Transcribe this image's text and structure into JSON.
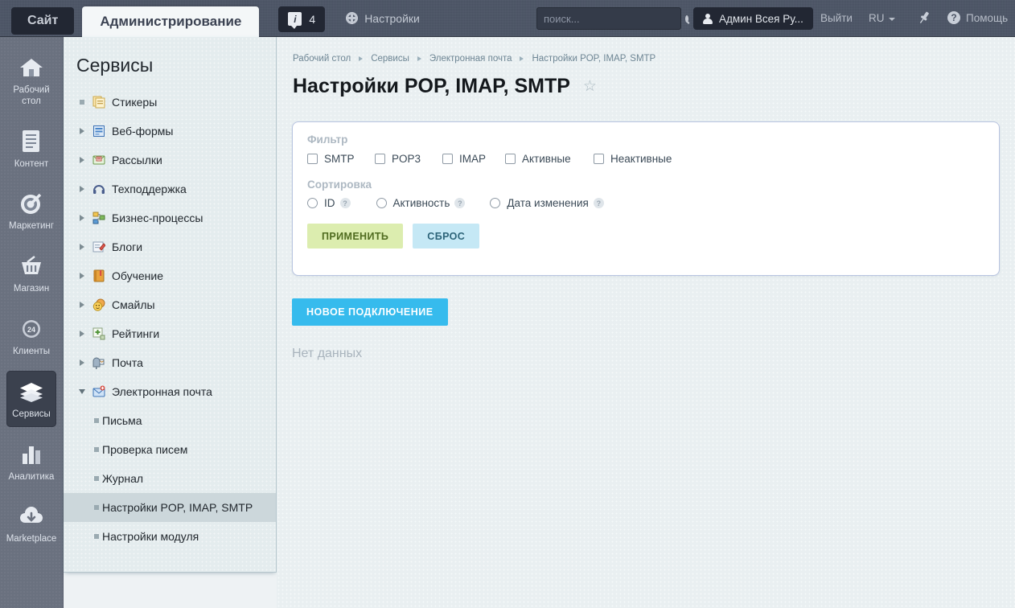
{
  "topbar": {
    "tab_site": "Сайт",
    "tab_admin": "Администрирование",
    "notification_count": "4",
    "notification_icon": "info-icon",
    "settings_label": "Настройки",
    "settings_icon": "gear-icon",
    "search_placeholder": "поиск...",
    "search_value": "",
    "search_icon": "search-icon",
    "user_name": "Админ Всея Ру...",
    "user_icon": "person-icon",
    "logout_label": "Выйти",
    "language": "RU",
    "pin_icon": "pin-icon",
    "help_label": "Помощь",
    "help_icon": "question-icon"
  },
  "rail": {
    "items": [
      {
        "label": "Рабочий стол",
        "icon": "home-icon",
        "active": false
      },
      {
        "label": "Контент",
        "icon": "document-icon",
        "active": false
      },
      {
        "label": "Маркетинг",
        "icon": "target-icon",
        "active": false
      },
      {
        "label": "Магазин",
        "icon": "basket-icon",
        "active": false
      },
      {
        "label": "Клиенты",
        "icon": "cloud24-icon",
        "active": false
      },
      {
        "label": "Сервисы",
        "icon": "layers-icon",
        "active": true
      },
      {
        "label": "Аналитика",
        "icon": "barchart-icon",
        "active": false
      },
      {
        "label": "Marketplace",
        "icon": "cloud-download-icon",
        "active": false
      }
    ]
  },
  "menu": {
    "title": "Сервисы",
    "items": [
      {
        "label": "Стикеры",
        "marker": "dot",
        "icon": "stickers-icon",
        "level": 0,
        "selected": false
      },
      {
        "label": "Веб-формы",
        "marker": "right",
        "icon": "webform-icon",
        "level": 0,
        "selected": false
      },
      {
        "label": "Рассылки",
        "marker": "right",
        "icon": "mailing-icon",
        "level": 0,
        "selected": false
      },
      {
        "label": "Техподдержка",
        "marker": "right",
        "icon": "support-icon",
        "level": 0,
        "selected": false
      },
      {
        "label": "Бизнес-процессы",
        "marker": "right",
        "icon": "bizproc-icon",
        "level": 0,
        "selected": false
      },
      {
        "label": "Блоги",
        "marker": "right",
        "icon": "blog-icon",
        "level": 0,
        "selected": false
      },
      {
        "label": "Обучение",
        "marker": "right",
        "icon": "learning-icon",
        "level": 0,
        "selected": false
      },
      {
        "label": "Смайлы",
        "marker": "right",
        "icon": "smiley-icon",
        "level": 0,
        "selected": false
      },
      {
        "label": "Рейтинги",
        "marker": "right",
        "icon": "rating-icon",
        "level": 0,
        "selected": false
      },
      {
        "label": "Почта",
        "marker": "right",
        "icon": "mailbox-icon",
        "level": 0,
        "selected": false
      },
      {
        "label": "Электронная почта",
        "marker": "down",
        "icon": "email-icon",
        "level": 0,
        "selected": false
      },
      {
        "label": "Письма",
        "marker": "dot",
        "icon": "",
        "level": 1,
        "selected": false
      },
      {
        "label": "Проверка писем",
        "marker": "dot",
        "icon": "",
        "level": 1,
        "selected": false
      },
      {
        "label": "Журнал",
        "marker": "dot",
        "icon": "",
        "level": 1,
        "selected": false
      },
      {
        "label": "Настройки POP, IMAP, SMTP",
        "marker": "dot",
        "icon": "",
        "level": 1,
        "selected": true
      },
      {
        "label": "Настройки модуля",
        "marker": "dot",
        "icon": "",
        "level": 1,
        "selected": false
      }
    ]
  },
  "main": {
    "breadcrumb": [
      "Рабочий стол",
      "Сервисы",
      "Электронная почта",
      "Настройки POP, IMAP, SMTP"
    ],
    "page_title": "Настройки POP, IMAP, SMTP",
    "favorite_icon": "star-icon",
    "filter": {
      "filter_label": "Фильтр",
      "checkboxes": [
        {
          "label": "SMTP",
          "checked": false
        },
        {
          "label": "POP3",
          "checked": false
        },
        {
          "label": "IMAP",
          "checked": false
        },
        {
          "label": "Активные",
          "checked": false
        },
        {
          "label": "Неактивные",
          "checked": false
        }
      ],
      "sort_label": "Сортировка",
      "radios": [
        {
          "label": "ID",
          "checked": false,
          "help": "?"
        },
        {
          "label": "Активность",
          "checked": false,
          "help": "?"
        },
        {
          "label": "Дата изменения",
          "checked": false,
          "help": "?"
        }
      ],
      "apply_label": "ПРИМЕНИТЬ",
      "reset_label": "СБРОС"
    },
    "new_connection_label": "НОВОЕ ПОДКЛЮЧЕНИЕ",
    "empty_text": "Нет данных"
  },
  "colors": {
    "topbar": "#4c5566",
    "accent_blue": "#36bbed",
    "apply_green": "#dcedaf",
    "reset_blue": "#c5e8f5",
    "content_bg": "#e9eff1",
    "menu_bg": "#e4ecee",
    "selected_row": "#ccd7db"
  }
}
